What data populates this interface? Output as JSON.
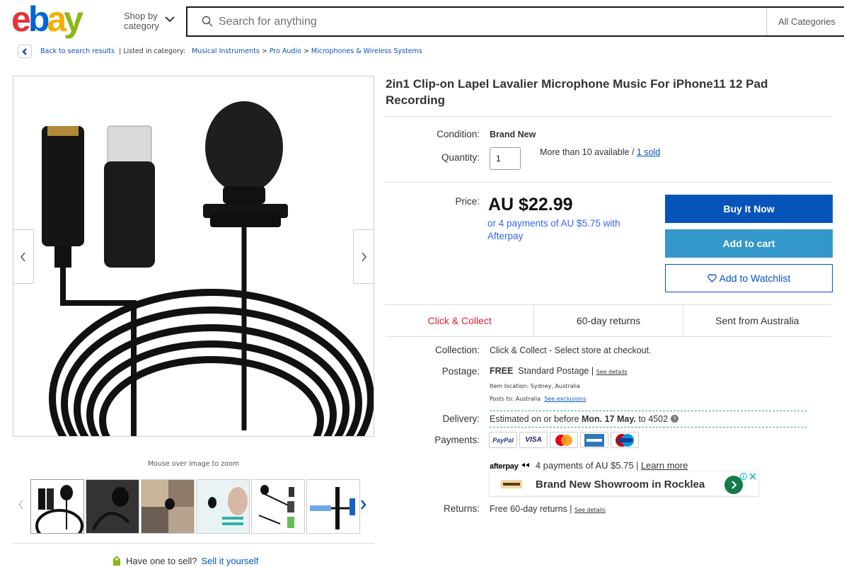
{
  "header": {
    "logo_text": "ebay",
    "shop_by": "Shop by",
    "shop_by_category": "category",
    "search_placeholder": "Search for anything",
    "all_categories": "All Categories"
  },
  "breadcrumb": {
    "back": "Back to search results",
    "listed_in": "| Listed in category:",
    "crumbs": [
      "Musical Instruments",
      "Pro Audio",
      "Microphones & Wireless Systems"
    ]
  },
  "gallery": {
    "zoom_hint": "Mouse over image to zoom",
    "thumbnail_count": 6
  },
  "sell": {
    "question": "Have one to sell?",
    "link": "Sell it yourself"
  },
  "item": {
    "title": "2in1 Clip-on Lapel Lavalier Microphone Music For iPhone11 12 Pad Recording",
    "condition_label": "Condition:",
    "condition_value": "Brand New",
    "quantity_label": "Quantity:",
    "quantity_value": "1",
    "availability": "More than 10 available /",
    "sold": "1 sold",
    "price_label": "Price:",
    "price": "AU $22.99",
    "afterpay_text": "or 4 payments of AU $5.75 with Afterpay"
  },
  "buttons": {
    "buy_now": "Buy It Now",
    "add_to_cart": "Add to cart",
    "watchlist": "Add to Watchlist"
  },
  "features": [
    "Click & Collect",
    "60-day returns",
    "Sent from Australia"
  ],
  "shipping": {
    "collection_label": "Collection:",
    "collection_value": "Click & Collect - Select store at checkout.",
    "postage_label": "Postage:",
    "postage_free": "FREE",
    "postage_value": "Standard Postage |",
    "see_details": "See details",
    "item_location": "Item location:  Sydney, Australia",
    "posts_to": "Posts to:  Australia",
    "see_exclusions": "See exclusions",
    "delivery_label": "Delivery:",
    "delivery_prefix": "Estimated on or before",
    "delivery_date": "Mon. 17 May.",
    "delivery_suffix": "to 4502",
    "payments_label": "Payments:",
    "payment_methods": [
      "PayPal",
      "VISA",
      "Mastercard",
      "American Express",
      "Maestro"
    ],
    "afterpay_brand": "afterpay",
    "afterpay_info": "4 payments of AU $5.75",
    "learn_more": "Learn more",
    "returns_label": "Returns:",
    "returns_value": "Free 60-day returns |",
    "returns_details": "See details"
  },
  "ad": {
    "text": "Brand New Showroom in Rocklea"
  },
  "colors": {
    "ebay_red": "#e53238",
    "ebay_blue": "#0064d2",
    "ebay_yellow": "#f5af02",
    "ebay_green": "#86b817",
    "buy_now": "#0654ba",
    "add_to_cart": "#3498ca",
    "link": "#0654ba",
    "afterpay_mint": "#b2fce4"
  }
}
